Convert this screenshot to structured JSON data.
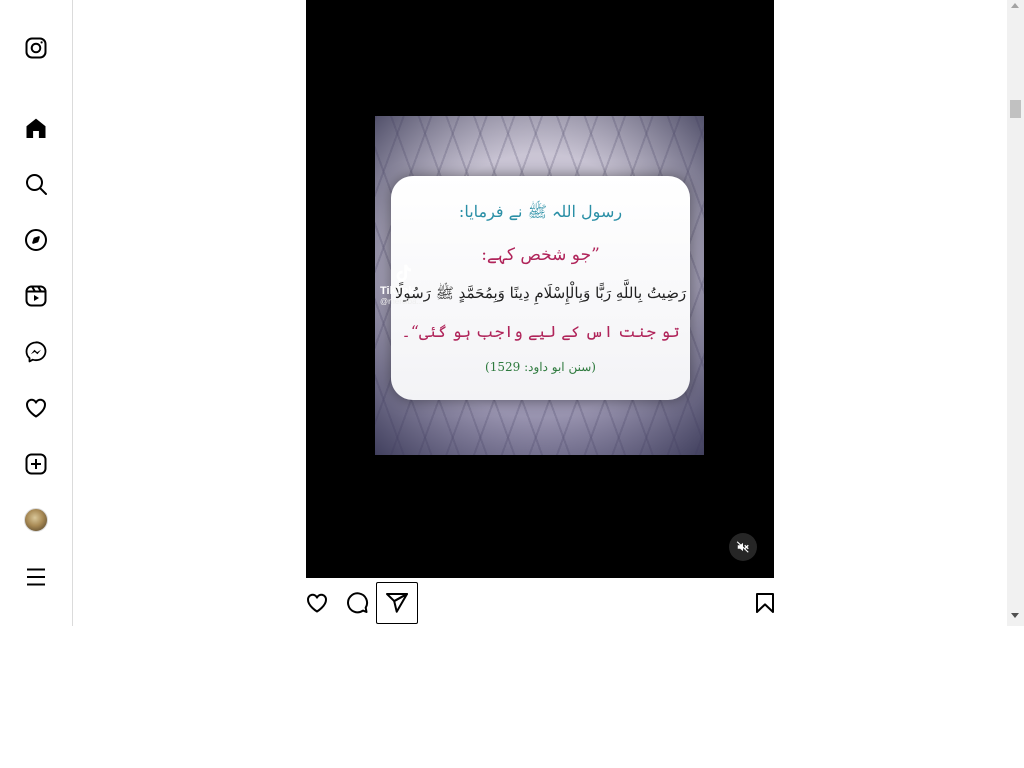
{
  "sidebar": {
    "items": [
      {
        "name": "instagram-logo-icon",
        "label": "Instagram"
      },
      {
        "name": "home-icon",
        "label": "Home"
      },
      {
        "name": "search-icon",
        "label": "Search"
      },
      {
        "name": "explore-icon",
        "label": "Explore"
      },
      {
        "name": "reels-icon",
        "label": "Reels"
      },
      {
        "name": "messenger-icon",
        "label": "Messages"
      },
      {
        "name": "heart-icon",
        "label": "Notifications"
      },
      {
        "name": "create-icon",
        "label": "Create"
      },
      {
        "name": "avatar",
        "label": "Profile"
      },
      {
        "name": "menu-icon",
        "label": "More"
      }
    ]
  },
  "post": {
    "card": {
      "line1": "رسول اللہ ﷺ نے فرمایا:",
      "line2": "”جو شخص کہے:",
      "line3": "رَضِيتُ بِاللَّهِ رَبًّا وَبِالْإِسْلَامِ دِينًا وَبِمُحَمَّدٍ ﷺ رَسُولًا",
      "line4": "تو جنت اس کے لیے واجب ہو گئی“۔",
      "line5": "(سنن ابو داود: 1529)"
    },
    "watermark": {
      "brand": "TikTok",
      "handle": "@merciba..."
    }
  },
  "colors": {
    "border": "#dbdbdb",
    "urdu_blue": "#2a8fa6",
    "urdu_red": "#b0245a",
    "urdu_green": "#2e7a3e"
  }
}
